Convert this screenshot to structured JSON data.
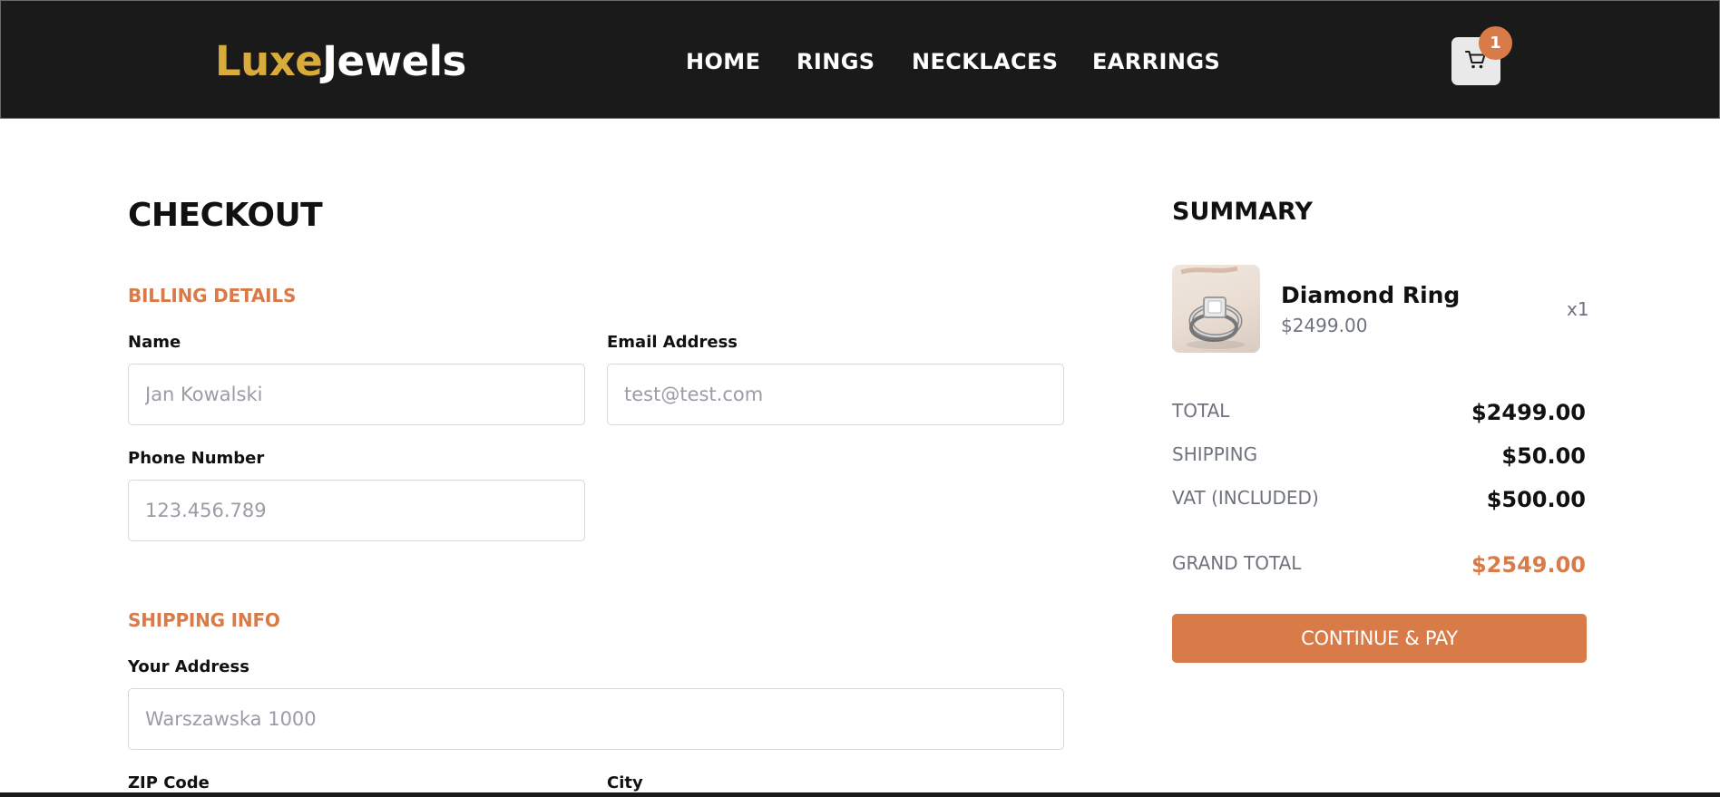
{
  "header": {
    "logo_part1": "Luxe",
    "logo_part2": "Jewels",
    "nav": [
      "HOME",
      "RINGS",
      "NECKLACES",
      "EARRINGS"
    ],
    "cart_icon": "cart-icon",
    "cart_count": "1"
  },
  "checkout": {
    "title": "CHECKOUT",
    "billing": {
      "title": "BILLING DETAILS",
      "name_label": "Name",
      "name_placeholder": "Jan Kowalski",
      "email_label": "Email Address",
      "email_placeholder": "test@test.com",
      "phone_label": "Phone Number",
      "phone_placeholder": "123.456.789"
    },
    "shipping": {
      "title": "SHIPPING INFO",
      "address_label": "Your Address",
      "address_placeholder": "Warszawska 1000",
      "zip_label": "ZIP Code",
      "city_label": "City"
    }
  },
  "summary": {
    "title": "SUMMARY",
    "item": {
      "name": "Diamond Ring",
      "price": "$2499.00",
      "qty": "x1",
      "image_icon": "diamond-ring-image"
    },
    "total_label": "TOTAL",
    "total_value": "$2499.00",
    "shipping_label": "SHIPPING",
    "shipping_value": "$50.00",
    "vat_label": "VAT (INCLUDED)",
    "vat_value": "$500.00",
    "grand_total_label": "GRAND TOTAL",
    "grand_total_value": "$2549.00",
    "pay_button": "CONTINUE & PAY"
  },
  "colors": {
    "header_bg": "#1a1a1a",
    "logo_accent": "#d9ab3a",
    "accent": "#d97b48",
    "muted_text": "#6f7380",
    "input_border": "#d7d7d7"
  }
}
